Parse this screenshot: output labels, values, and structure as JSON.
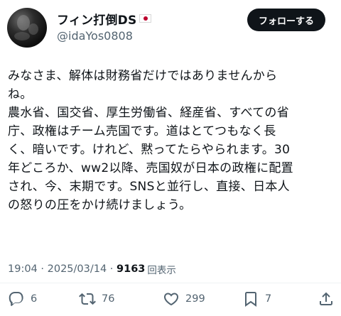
{
  "user": {
    "display_name": "フィン打倒DS",
    "handle": "@idaYos0808",
    "follow_label": "フォローする"
  },
  "tweet": {
    "text": "みなさま、解体は財務省だけではありませんから\nね。\n農水省、国交省、厚生労働省、経産省、すべての省\n庁、政権はチーム売国です。道はとてつもなく長\nく、暗いです。けれど、黙ってたらやられます。30\n年どころか、ww2以降、売国奴が日本の政権に配置\nされ、今、末期です。SNSと並行し、直接、日本人\nの怒りの圧をかけ続けましょう。"
  },
  "meta": {
    "time": "19:04",
    "separator": " · ",
    "date": "2025/03/14",
    "views": "9163",
    "views_label": "回表示"
  },
  "actions": {
    "replies": "6",
    "reposts": "76",
    "likes": "299",
    "bookmarks": "7"
  },
  "icons": [
    "japan-flag-icon",
    "reply-icon",
    "repost-icon",
    "like-icon",
    "bookmark-icon",
    "share-icon"
  ],
  "colors": {
    "text": "#0f1419",
    "muted": "#536471",
    "button_bg": "#0f1419",
    "button_text": "#ffffff",
    "flag_red": "#bc002d"
  }
}
